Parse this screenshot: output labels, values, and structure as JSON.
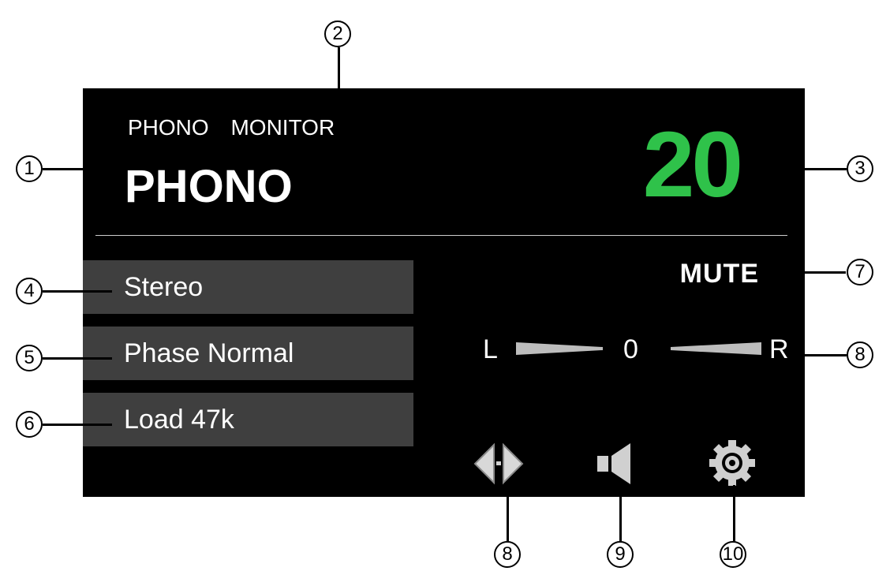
{
  "header": {
    "sources": [
      "PHONO",
      "MONITOR"
    ],
    "input_name": "PHONO",
    "volume": "20"
  },
  "buttons": [
    {
      "label": "Stereo"
    },
    {
      "label": "Phase Normal"
    },
    {
      "label": "Load 47k"
    }
  ],
  "status": {
    "mute": "MUTE"
  },
  "balance": {
    "left_label": "L",
    "value": "0",
    "right_label": "R"
  },
  "icons": [
    "balance-icon",
    "speaker-icon",
    "settings-gear-icon"
  ],
  "colors": {
    "volume": "#2fc24a",
    "button_bg": "#3f3f3f",
    "screen_bg": "#000000"
  },
  "callouts": [
    "1",
    "2",
    "3",
    "4",
    "5",
    "6",
    "7",
    "8",
    "8",
    "9",
    "10"
  ]
}
